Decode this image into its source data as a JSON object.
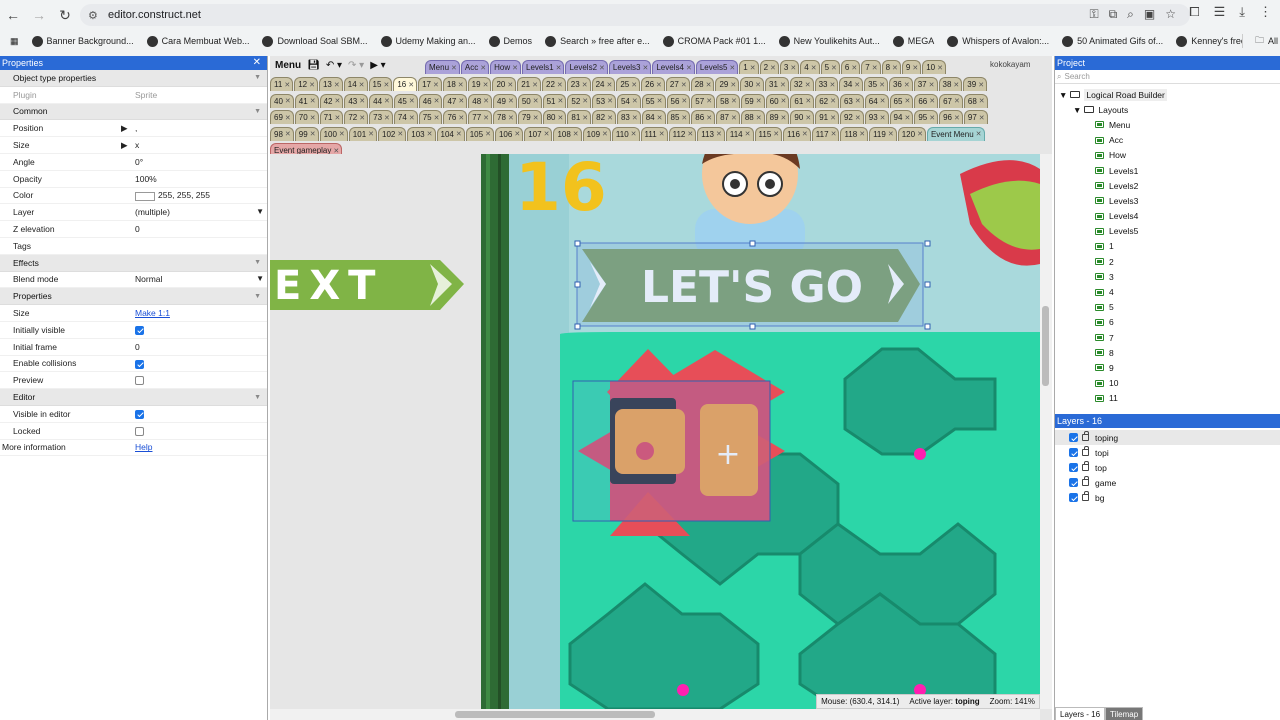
{
  "browser": {
    "url": "editor.construct.net",
    "bookmarks": [
      "Banner Background...",
      "Cara Membuat Web...",
      "Download Soal SBM...",
      "Udemy Making an...",
      "Demos",
      "Search » free after e...",
      "CROMA Pack #01 1...",
      "New Youlikehits Aut...",
      "MEGA",
      "Whispers of Avalon:...",
      "50 Animated Gifs of...",
      "Kenney's free assets..."
    ],
    "all_bookmarks": "All"
  },
  "properties": {
    "header": "Properties",
    "section_object_type": "Object type properties",
    "plugin_label": "Plugin",
    "plugin_value": "Sprite",
    "section_common": "Common",
    "position_label": "Position",
    "position_value": ",",
    "size_label": "Size",
    "size_value": "x",
    "angle_label": "Angle",
    "angle_value": "0°",
    "opacity_label": "Opacity",
    "opacity_value": "100%",
    "color_label": "Color",
    "color_value": "255, 255, 255",
    "layer_label": "Layer",
    "layer_value": "(multiple)",
    "zelev_label": "Z elevation",
    "zelev_value": "0",
    "tags_label": "Tags",
    "section_effects": "Effects",
    "blend_label": "Blend mode",
    "blend_value": "Normal",
    "section_properties": "Properties",
    "size2_label": "Size",
    "size2_link": "Make 1:1",
    "init_visible_label": "Initially visible",
    "init_frame_label": "Initial frame",
    "init_frame_value": "0",
    "enable_coll_label": "Enable collisions",
    "preview_label": "Preview",
    "section_editor": "Editor",
    "visible_editor_label": "Visible in editor",
    "locked_label": "Locked",
    "more_info_label": "More information",
    "more_info_link": "Help"
  },
  "editor": {
    "menu_label": "Menu",
    "tab_rows": [
      [
        "Menu",
        "Acc",
        "How",
        "Levels1",
        "Levels2",
        "Levels3",
        "Levels4",
        "Levels5",
        "1",
        "2",
        "3",
        "4",
        "5",
        "6",
        "7",
        "8",
        "9",
        "10"
      ],
      [
        "11",
        "12",
        "13",
        "14",
        "15",
        "16",
        "17",
        "18",
        "19",
        "20",
        "21",
        "22",
        "23",
        "24",
        "25",
        "26",
        "27",
        "28",
        "29",
        "30",
        "31",
        "32",
        "33",
        "34",
        "35",
        "36",
        "37",
        "38",
        "39"
      ],
      [
        "40",
        "41",
        "42",
        "43",
        "44",
        "45",
        "46",
        "47",
        "48",
        "49",
        "50",
        "51",
        "52",
        "53",
        "54",
        "55",
        "56",
        "57",
        "58",
        "59",
        "60",
        "61",
        "62",
        "63",
        "64",
        "65",
        "66",
        "67",
        "68"
      ],
      [
        "69",
        "70",
        "71",
        "72",
        "73",
        "74",
        "75",
        "76",
        "77",
        "78",
        "79",
        "80",
        "81",
        "82",
        "83",
        "84",
        "85",
        "86",
        "87",
        "88",
        "89",
        "90",
        "91",
        "92",
        "93",
        "94",
        "95",
        "96",
        "97"
      ],
      [
        "98",
        "99",
        "100",
        "101",
        "102",
        "103",
        "104",
        "105",
        "106",
        "107",
        "108",
        "109",
        "110",
        "111",
        "112",
        "113",
        "114",
        "115",
        "116",
        "117",
        "118",
        "119",
        "120",
        "Event Menu"
      ],
      [
        "Event gameplay"
      ]
    ],
    "active_tab": "16",
    "user": "kokokayam",
    "canvas_texts": {
      "level_number": "16",
      "next_text": "EXT",
      "letsgo_text": "LET'S GO"
    },
    "status": {
      "mouse": "Mouse: (630.4, 314.1)",
      "active_layer_label": "Active layer:",
      "active_layer": "toping",
      "zoom": "Zoom: 141%"
    }
  },
  "project": {
    "header": "Project",
    "search_placeholder": "Search",
    "root": "Logical Road Builder",
    "layouts_folder": "Layouts",
    "layouts": [
      "Menu",
      "Acc",
      "How",
      "Levels1",
      "Levels2",
      "Levels3",
      "Levels4",
      "Levels5",
      "1",
      "2",
      "3",
      "4",
      "5",
      "6",
      "7",
      "8",
      "9",
      "10",
      "11"
    ]
  },
  "layers": {
    "header": "Layers - 16",
    "items": [
      "toping",
      "topi",
      "top",
      "game",
      "bg"
    ],
    "bottom_tabs": [
      "Layers - 16",
      "Tilemap"
    ]
  },
  "colors": {
    "accent": "#2a6ad6",
    "tile": "#2cd6a8",
    "grass": "#2e7d32",
    "letsgo": "#7a9a6a",
    "car_bg": "#d84a6a"
  }
}
